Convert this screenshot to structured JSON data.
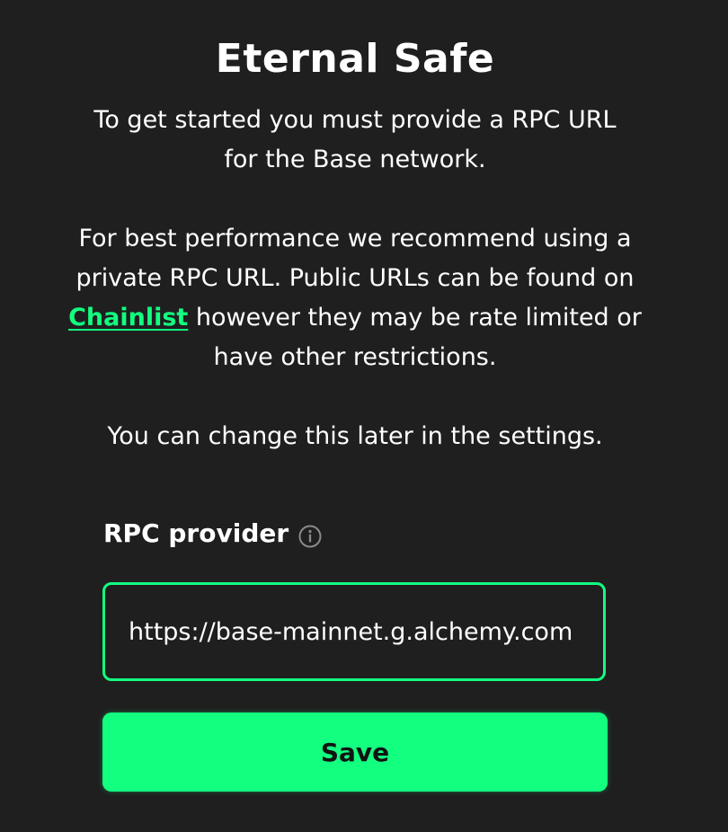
{
  "title": "Eternal Safe",
  "intro": {
    "line1": "To get started you must provide a RPC URL",
    "line2": "for the Base network."
  },
  "performance": {
    "before_link": "For best performance we recommend using a private RPC URL. Public URLs can be found on ",
    "link_text": "Chainlist",
    "after_link": " however they may be rate limited or have other restrictions."
  },
  "settings_note": "You can change this later in the settings.",
  "rpc_field": {
    "label": "RPC provider",
    "value": "https://base-mainnet.g.alchemy.com",
    "info_icon": "info-circle-icon"
  },
  "save_button": {
    "label": "Save"
  },
  "colors": {
    "background": "#1f1f1f",
    "accent": "#12ff80",
    "text": "#ffffff",
    "button_text": "#121312"
  }
}
